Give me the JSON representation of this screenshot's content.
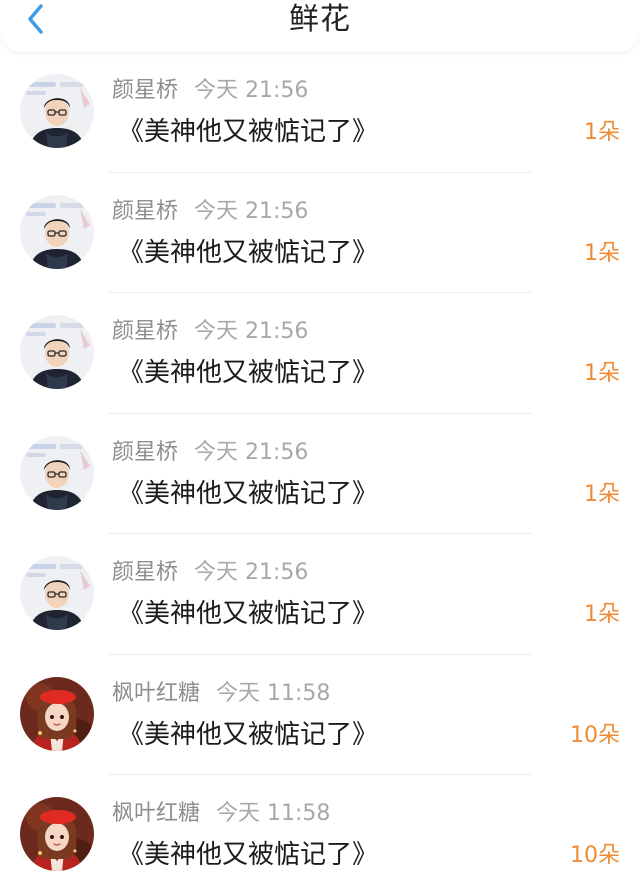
{
  "header": {
    "title": "鲜花",
    "back_icon": "chevron-left-icon",
    "accent_color": "#3a9be8"
  },
  "records": [
    {
      "user": "颜星桥",
      "time": "今天 21:56",
      "book": "《美神他又被惦记了》",
      "amount": "1朵",
      "avatar": "boy-glasses-avatar"
    },
    {
      "user": "颜星桥",
      "time": "今天 21:56",
      "book": "《美神他又被惦记了》",
      "amount": "1朵",
      "avatar": "boy-glasses-avatar"
    },
    {
      "user": "颜星桥",
      "time": "今天 21:56",
      "book": "《美神他又被惦记了》",
      "amount": "1朵",
      "avatar": "boy-glasses-avatar"
    },
    {
      "user": "颜星桥",
      "time": "今天 21:56",
      "book": "《美神他又被惦记了》",
      "amount": "1朵",
      "avatar": "boy-glasses-avatar"
    },
    {
      "user": "颜星桥",
      "time": "今天 21:56",
      "book": "《美神他又被惦记了》",
      "amount": "1朵",
      "avatar": "boy-glasses-avatar"
    },
    {
      "user": "枫叶红糖",
      "time": "今天 11:58",
      "book": "《美神他又被惦记了》",
      "amount": "10朵",
      "avatar": "girl-red-beret-avatar"
    },
    {
      "user": "枫叶红糖",
      "time": "今天 11:58",
      "book": "《美神他又被惦记了》",
      "amount": "10朵",
      "avatar": "girl-red-beret-avatar"
    }
  ],
  "colors": {
    "amount": "#f08a35",
    "username": "#8d8d8d",
    "timestamp": "#a8a8a8",
    "book_title": "#1c1c1c"
  }
}
